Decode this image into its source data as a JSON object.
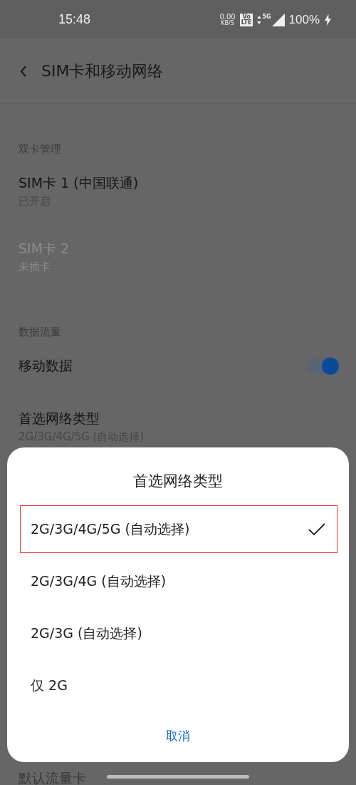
{
  "status_bar": {
    "time": "15:48",
    "net_speed": "0.00",
    "net_unit": "KB/S",
    "volte_top": "Vo",
    "volte_bottom": "LTE",
    "network": "5G",
    "battery": "100%",
    "charging": true
  },
  "header": {
    "title": "SIM卡和移动网络"
  },
  "sections": [
    {
      "title": "双卡管理",
      "items": [
        {
          "kind": "entry",
          "title": "SIM卡 1  (中国联通)",
          "subtitle": "已开启",
          "disabled": false
        },
        {
          "kind": "entry",
          "title": "SIM卡 2",
          "subtitle": "未插卡",
          "disabled": true
        }
      ]
    },
    {
      "title": "数据流量",
      "items": [
        {
          "kind": "switch",
          "title": "移动数据",
          "on": true
        },
        {
          "kind": "entry",
          "title": "首选网络类型",
          "subtitle": "2G/3G/4G/5G (自动选择)",
          "disabled": false
        }
      ]
    }
  ],
  "behind_dialog": {
    "title": "默认流量卡"
  },
  "dialog": {
    "title": "首选网络类型",
    "options": [
      {
        "label": "2G/3G/4G/5G (自动选择)",
        "selected": true,
        "highlighted": true
      },
      {
        "label": "2G/3G/4G (自动选择)",
        "selected": false,
        "highlighted": false
      },
      {
        "label": "2G/3G (自动选择)",
        "selected": false,
        "highlighted": false
      },
      {
        "label": "仅 2G",
        "selected": false,
        "highlighted": false
      }
    ],
    "cancel": "取消"
  }
}
